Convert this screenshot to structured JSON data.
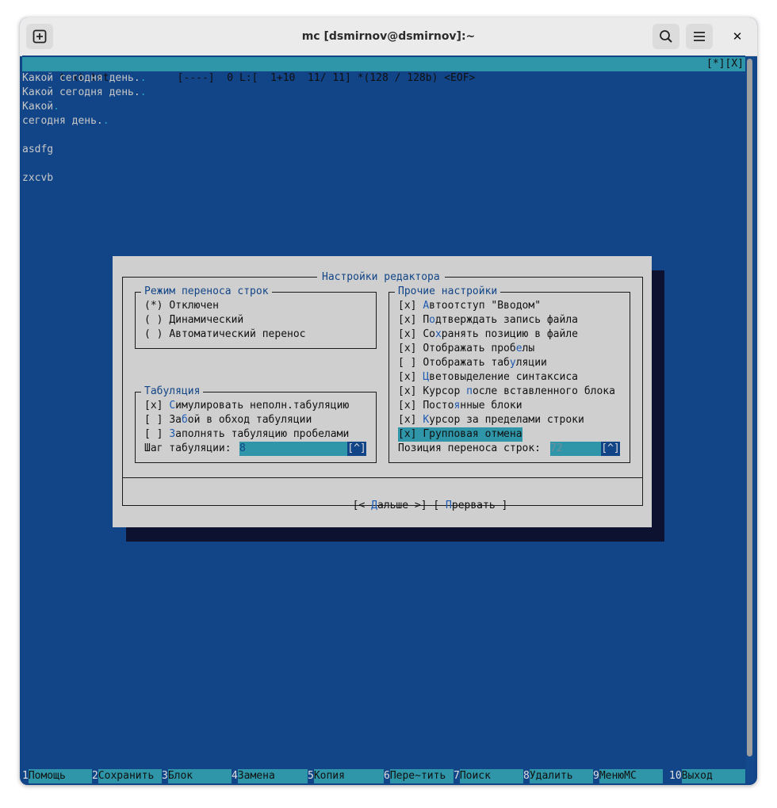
{
  "window": {
    "title": "mc [dsmirnov@dsmirnov]:~"
  },
  "status_bar": {
    "left": "text.txt           [----]  0 L:[  1+10  11/ 11] *(128 / 128b) <EOF>",
    "right": "[*][X]"
  },
  "editor": {
    "lines": [
      {
        "text": "Какой сегодня день.",
        "tail": "."
      },
      {
        "text": "Какой сегодня день.",
        "tail": "."
      },
      {
        "text": "Какой",
        "tail": "."
      },
      {
        "text": "сегодня день.",
        "tail": "."
      },
      {
        "text": "",
        "tail": ""
      },
      {
        "text": "asdfg",
        "tail": ""
      },
      {
        "text": "",
        "tail": ""
      },
      {
        "text": "zxcvb",
        "tail": ""
      }
    ]
  },
  "dialog": {
    "title": "Настройки редактора",
    "wrap_group": {
      "title": "Режим переноса строк",
      "options": [
        {
          "mark": "(*)",
          "label": "Отключен"
        },
        {
          "mark": "( )",
          "label": "Динамический"
        },
        {
          "mark": "( )",
          "label": "Автоматический перенос"
        }
      ]
    },
    "tab_group": {
      "title": "Табуляция",
      "options": [
        {
          "mark": "[x]",
          "pre": "",
          "hk": "С",
          "post": "имулировать неполн.табуляцию"
        },
        {
          "mark": "[ ]",
          "pre": "За",
          "hk": "б",
          "post": "ой в обход табуляции"
        },
        {
          "mark": "[ ]",
          "pre": "",
          "hk": "З",
          "post": "аполнять табуляцию пробелами"
        }
      ],
      "step_label": "Шаг табуляции:",
      "step_value": "8",
      "history_button": "[^]"
    },
    "other_group": {
      "title": "Прочие настройки",
      "options": [
        {
          "mark": "[x]",
          "pre": "",
          "hk": "А",
          "post": "втоотступ \"Вводом\""
        },
        {
          "mark": "[x]",
          "pre": "П",
          "hk": "о",
          "post": "дтверждать запись файла"
        },
        {
          "mark": "[x]",
          "pre": "Со",
          "hk": "х",
          "post": "ранять позицию в файле"
        },
        {
          "mark": "[x]",
          "pre": "Отображать проб",
          "hk": "е",
          "post": "лы"
        },
        {
          "mark": "[ ]",
          "pre": "Отображать таб",
          "hk": "у",
          "post": "ляции"
        },
        {
          "mark": "[x]",
          "pre": "",
          "hk": "Ц",
          "post": "ветовыделение синтаксиса"
        },
        {
          "mark": "[x]",
          "pre": "Курсор ",
          "hk": "п",
          "post": "осле вставленного блока"
        },
        {
          "mark": "[x]",
          "pre": "Посто",
          "hk": "я",
          "post": "нные блоки"
        },
        {
          "mark": "[x]",
          "pre": "",
          "hk": "К",
          "post": "урсор за пределами строки"
        },
        {
          "mark": "[x]",
          "pre": "",
          "hk": "Г",
          "post": "рупповая отмена"
        }
      ],
      "wrap_label": "Позиция переноса строк:",
      "wrap_value": "72",
      "history_button": "[^]"
    },
    "buttons": {
      "next_open": "[< ",
      "next_hk": "Д",
      "next_rest": "альше >]",
      "abort_open": "[ ",
      "abort_hk": "П",
      "abort_rest": "рервать ]"
    }
  },
  "fkeys": [
    {
      "num": "1",
      "label": "Помощь"
    },
    {
      "num": "2",
      "label": "Сохранить"
    },
    {
      "num": "3",
      "label": "Блок"
    },
    {
      "num": "4",
      "label": "Замена"
    },
    {
      "num": "5",
      "label": "Копия"
    },
    {
      "num": "6",
      "label": "Пере~тить"
    },
    {
      "num": "7",
      "label": "Поиск"
    },
    {
      "num": "8",
      "label": "Удалить"
    },
    {
      "num": "9",
      "label": "МенюMC"
    },
    {
      "num": "10",
      "label": "Выход"
    }
  ]
}
